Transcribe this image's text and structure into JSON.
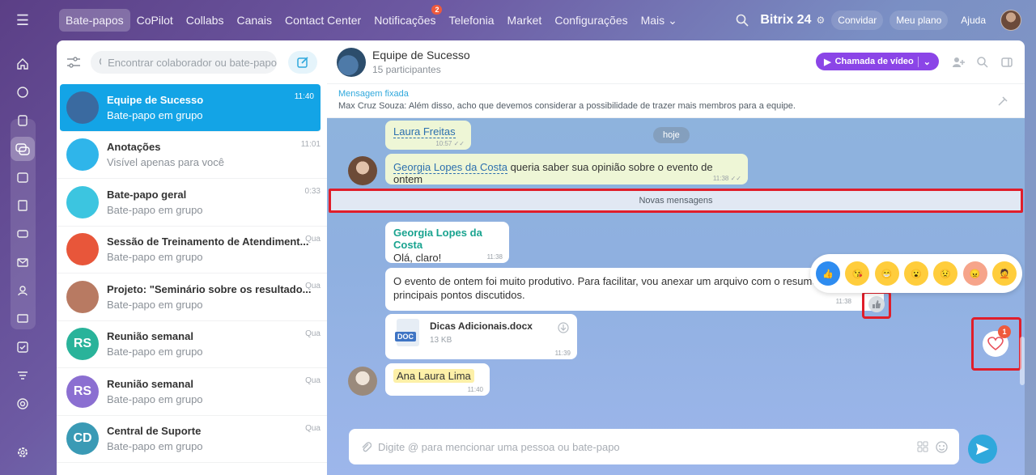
{
  "topbar": {
    "nav": [
      "Bate-papos",
      "CoPilot",
      "Collabs",
      "Canais",
      "Contact Center",
      "Notificações",
      "Telefonia",
      "Market",
      "Configurações",
      "Mais"
    ],
    "active_index": 0,
    "notif_badge": "2",
    "brand": "Bitrix 24",
    "invite": "Convidar",
    "plan": "Meu plano",
    "help": "Ajuda"
  },
  "rail": {
    "icons": [
      "home-icon",
      "feed-icon",
      "tasks-board-icon",
      "chat-icon",
      "calendar-icon",
      "docs-icon",
      "drive-icon",
      "mail-icon",
      "contacts-icon",
      "crm-icon",
      "checklist-icon",
      "filter-icon",
      "target-icon",
      "settings-icon"
    ]
  },
  "chatlist": {
    "search_placeholder": "Encontrar colaborador ou bate-papo",
    "items": [
      {
        "title": "Equipe de Sucesso",
        "sub": "Bate-papo em grupo",
        "time": "11:40",
        "avatar": "",
        "color": "#3a6aa0",
        "active": true
      },
      {
        "title": "Anotações",
        "sub": "Visível apenas para você",
        "time": "11:01",
        "avatar": "",
        "color": "#2fb5ea",
        "active": false
      },
      {
        "title": "Bate-papo geral",
        "sub": "Bate-papo em grupo",
        "time": "0:33",
        "avatar": "",
        "color": "#3cc5e0",
        "active": false
      },
      {
        "title": "Sessão de Treinamento de Atendiment...",
        "sub": "Bate-papo em grupo",
        "time": "Qua",
        "avatar": "",
        "color": "#e8563a",
        "active": false
      },
      {
        "title": "Projeto: \"Seminário sobre os resultado...",
        "sub": "Bate-papo em grupo",
        "time": "Qua",
        "avatar": "",
        "color": "#b87a62",
        "active": false
      },
      {
        "title": "Reunião semanal",
        "sub": "Bate-papo em grupo",
        "time": "Qua",
        "avatar": "RS",
        "color": "#29b39a",
        "active": false
      },
      {
        "title": "Reunião semanal",
        "sub": "Bate-papo em grupo",
        "time": "Qua",
        "avatar": "RS",
        "color": "#8b6fd1",
        "active": false
      },
      {
        "title": "Central de Suporte",
        "sub": "Bate-papo em grupo",
        "time": "Qua",
        "avatar": "CD",
        "color": "#3a9ab5",
        "active": false
      }
    ]
  },
  "chat": {
    "title": "Equipe de Sucesso",
    "participants": "15 participantes",
    "video_call": "Chamada de vídeo",
    "pinned_label": "Mensagem fixada",
    "pinned_author": "Max Cruz Souza:",
    "pinned_text": "Além disso, acho que devemos considerar a possibilidade de trazer mais membros para a equipe.",
    "day": "hoje",
    "new_messages": "Novas mensagens",
    "messages": {
      "m1_mention": "Laura Freitas",
      "m1_time": "10:57",
      "m2_mention": "Georgia Lopes da Costa",
      "m2_text": "queria saber sua opinião sobre o evento de ontem",
      "m2_time": "11:38",
      "m3_author": "Georgia Lopes da Costa",
      "m3_text": "Olá, claro!",
      "m3_time": "11:38",
      "m4_text1": "O evento de ontem foi muito produtivo. Para facilitar, vou anexar um arquivo com o resumo e os",
      "m4_text2": "principais pontos discutidos.",
      "m4_time": "11:38",
      "file_name": "Dicas Adicionais.docx",
      "file_size": "13 KB",
      "file_type": "DOC",
      "file_time": "11:39",
      "m6_mention": "Ana Laura Lima",
      "m6_time": "11:40"
    },
    "reactions": [
      "like",
      "kiss",
      "laugh",
      "wow",
      "sad",
      "angry",
      "facepalm"
    ],
    "fav_badge": "1",
    "composer_placeholder": "Digite @ para mencionar uma pessoa ou bate-papo"
  }
}
